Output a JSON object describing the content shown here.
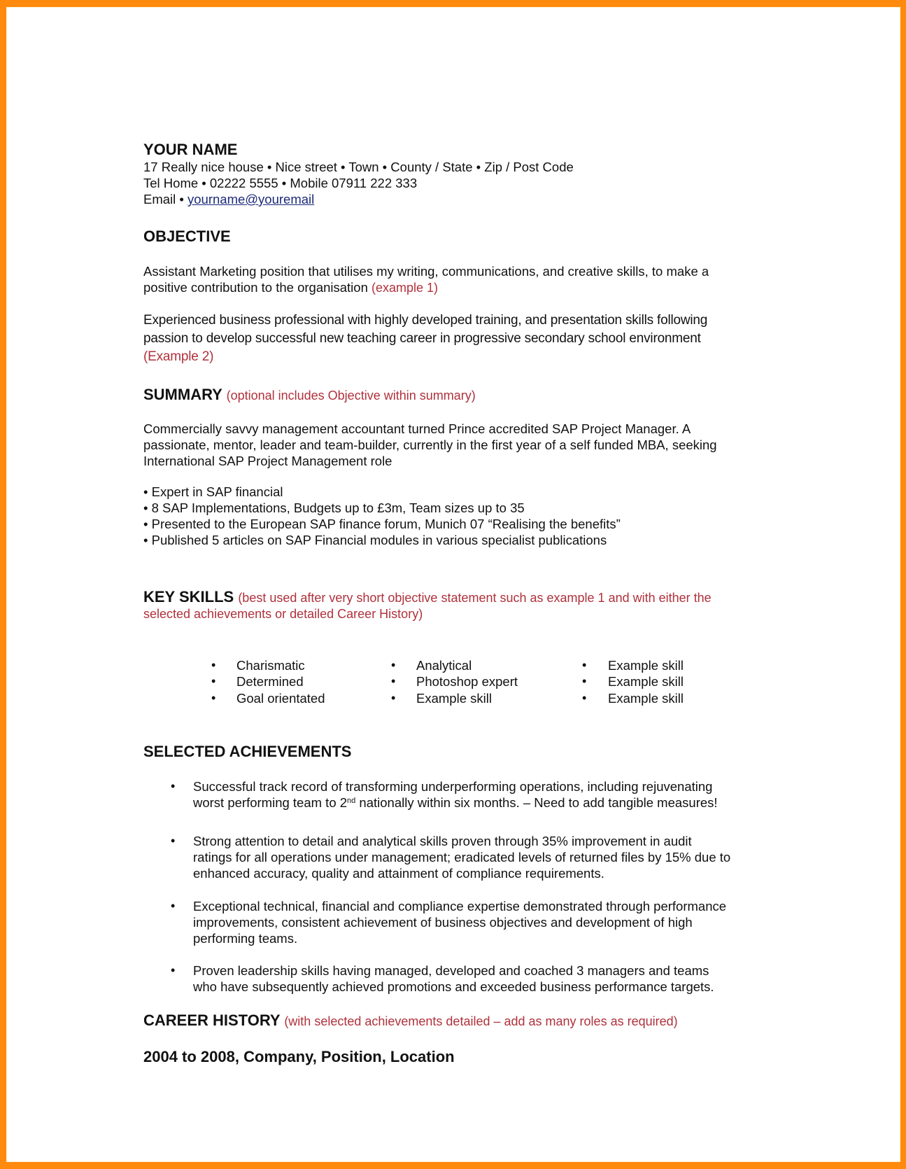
{
  "frame": {
    "border_color": "#ff8a0d"
  },
  "header": {
    "name": "YOUR NAME",
    "address": "17 Really nice house • Nice street • Town • County / State • Zip / Post Code",
    "phone": "Tel Home • 02222 5555 • Mobile 07911 222 333",
    "email_label": "Email • ",
    "email_link": "yourname@youremail"
  },
  "objective": {
    "title": "OBJECTIVE",
    "example1_line1": "Assistant Marketing position that utilises my writing, communications, and creative skills, to make a",
    "example1_line2": "positive contribution to the organisation ",
    "example1_note": "(example 1)",
    "example2_line1": "Experienced business professional with highly developed training, and presentation skills following",
    "example2_line2": "passion to develop successful new teaching career in progressive secondary school environment",
    "example2_note": "(Example 2)"
  },
  "summary": {
    "title": "SUMMARY",
    "note": "(optional includes Objective within summary)",
    "lines": [
      "Commercially savvy management accountant turned Prince accredited SAP Project Manager. A",
      "passionate, mentor, leader and team-builder, currently in the first year of a self funded MBA, seeking",
      "International SAP Project Management role"
    ],
    "bullets": [
      "• Expert in SAP financial",
      "• 8 SAP Implementations, Budgets up to £3m, Team sizes up to 35",
      "• Presented to the European SAP finance forum, Munich 07 “Realising the benefits”",
      "• Published 5 articles on SAP Financial modules in various specialist publications"
    ]
  },
  "key_skills": {
    "title": "KEY SKILLS",
    "note_line1": "(best used after very short objective statement such as example 1 and with either the",
    "note_line2": "selected achievements or detailed Career History)",
    "bullet": "•",
    "columns": [
      [
        "Charismatic",
        "Determined",
        "Goal orientated"
      ],
      [
        "Analytical",
        "Photoshop expert",
        "Example skill"
      ],
      [
        "Example skill",
        "Example skill",
        "Example skill"
      ]
    ]
  },
  "achievements": {
    "title": "SELECTED ACHIEVEMENTS",
    "bullet": "•",
    "items": [
      {
        "line1": "Successful track record of transforming underperforming operations, including rejuvenating",
        "line2_pre": "worst performing team to 2",
        "line2_sup": "nd",
        "line2_post": " nationally within six months. – Need to add tangible measures!"
      },
      {
        "line1": "Strong attention to detail and analytical skills proven through 35% improvement in audit",
        "line2": "ratings for all operations under management; eradicated levels of returned files by 15% due to",
        "line3": "enhanced accuracy, quality and attainment of compliance requirements."
      },
      {
        "line1": "Exceptional technical, financial and compliance expertise demonstrated through performance",
        "line2": "improvements, consistent achievement of business objectives and development of high",
        "line3": "performing teams."
      },
      {
        "line1": "Proven leadership skills having managed, developed and coached 3 managers and teams",
        "line2": "who have subsequently achieved promotions and exceeded business performance targets."
      }
    ]
  },
  "career_history": {
    "title": "CAREER HISTORY",
    "note": "(with selected achievements detailed – add as many roles as required)",
    "role": "2004 to 2008, Company, Position, Location"
  }
}
